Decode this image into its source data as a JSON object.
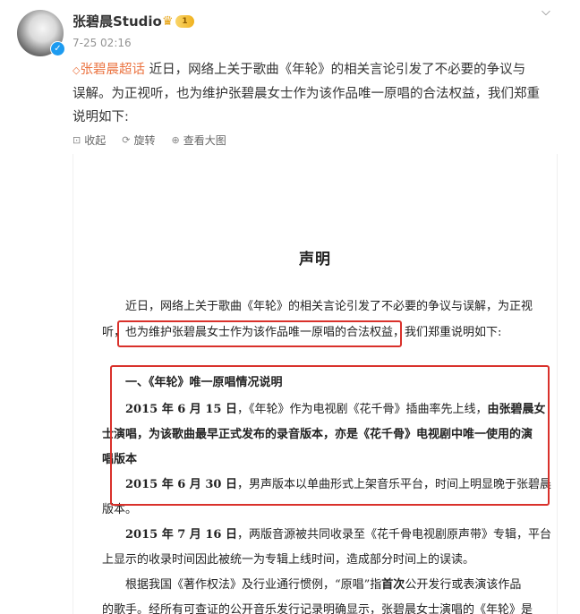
{
  "post": {
    "username": "张碧晨Studio",
    "level_badge": "1",
    "timestamp": "7-25 02:16",
    "topic_tag": "张碧晨超话",
    "text_line1_rest": " 近日，网络上关于歌曲《年轮》的相关言论引发了不必要的争议与",
    "text_line2": "误解。为正视听，也为维护张碧晨女士作为该作品唯一原唱的合法权益，我们郑重",
    "text_line3": "说明如下:"
  },
  "toolbar": {
    "collapse_label": "收起",
    "rotate_label": "旋转",
    "view_large_label": "查看大图"
  },
  "document": {
    "title": "声明",
    "p1_line1": "近日，网络上关于歌曲《年轮》的相关言论引发了不必要的争议与误解，为正视",
    "p1_line2_a": "听，",
    "p1_line2_b": "也为维护张碧晨女士作为该作品唯一原唱的合法权益，",
    "p1_line2_c": "我们郑重说明如下:",
    "section1_heading": "一、《年轮》唯一原唱情况说明",
    "s1_line1_a": "2015 年 6 月 15 日",
    "s1_line1_b": "，《年轮》作为电视剧《花千骨》插曲率先上线，",
    "s1_line1_c": "由张碧晨女",
    "s1_line2": "士演唱，为该歌曲最早正式发布的录音版本，亦是《花千骨》电视剧中唯一使用的演",
    "s1_line3": "唱版本",
    "s1_line4_a": "2015 年 6 月 30 日",
    "s1_line4_b": "，男声版本以单曲形式上架音乐平台，时间上明显晚于张碧晨",
    "s1_line5": "版本。",
    "p3_line1_a": "2015 年 7 月 16 日",
    "p3_line1_b": "，两版音源被共同收录至《花千骨电视剧原声带》专辑，平台",
    "p3_line2": "上显示的收录时间因此被统一为专辑上线时间，造成部分时间上的误读。",
    "p4_line1_a": "根据我国《著作权法》及行业通行惯例，“原唱”指",
    "p4_line1_b": "首次",
    "p4_line1_c": "公开发行或表演该作品",
    "p4_line2": "的歌手。经所有可查证的公开音乐发行记录明确显示，张碧晨女士演唱的《年轮》是"
  },
  "colors": {
    "topic": "#eb7340",
    "highlight_box": "#d9312b",
    "verified": "#1d9bf0"
  }
}
